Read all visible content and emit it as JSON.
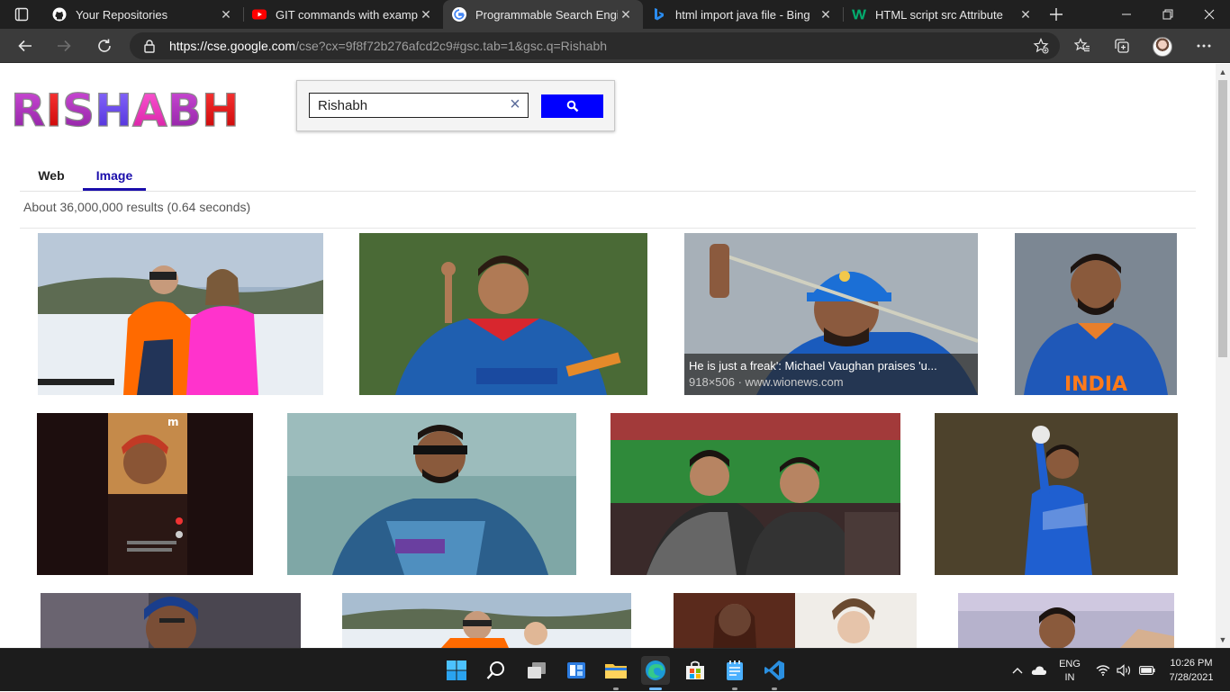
{
  "browser": {
    "tabs": [
      {
        "title": "Your Repositories",
        "icon": "github-icon"
      },
      {
        "title": "GIT commands with examples",
        "icon": "youtube-icon"
      },
      {
        "title": "Programmable Search Engine",
        "icon": "google-icon",
        "active": true
      },
      {
        "title": "html import java file - Bing",
        "icon": "bing-icon"
      },
      {
        "title": "HTML script src Attribute",
        "icon": "w3schools-icon"
      }
    ],
    "url_host": "https://cse.google.com",
    "url_rest": "/cse?cx=9f8f72b276afcd2c9#gsc.tab=1&gsc.q=Rishabh"
  },
  "page": {
    "logo_text": "RISHABH",
    "search": {
      "value": "Rishabh",
      "clear_label": "×"
    },
    "tabs": [
      {
        "label": "Web"
      },
      {
        "label": "Image",
        "active": true
      }
    ],
    "result_info": "About 36,000,000 results (0.64 seconds)",
    "images": [
      {
        "name": "image-result-1"
      },
      {
        "name": "image-result-2"
      },
      {
        "name": "image-result-3",
        "caption": "He is just a freak': Michael Vaughan praises 'u...",
        "meta": "918×506 · www.wionews.com"
      },
      {
        "name": "image-result-4",
        "overlay_text": "INDIA"
      },
      {
        "name": "image-result-5"
      },
      {
        "name": "image-result-6"
      },
      {
        "name": "image-result-7"
      },
      {
        "name": "image-result-8"
      },
      {
        "name": "image-result-9"
      },
      {
        "name": "image-result-10"
      },
      {
        "name": "image-result-11"
      },
      {
        "name": "image-result-12"
      }
    ]
  },
  "taskbar": {
    "language": "ENG",
    "region": "IN",
    "time": "10:26 PM",
    "date": "7/28/2021"
  },
  "colors": {
    "accent": "#1a0dab",
    "search_button": "#0000ff",
    "chrome_dark": "#202020"
  }
}
